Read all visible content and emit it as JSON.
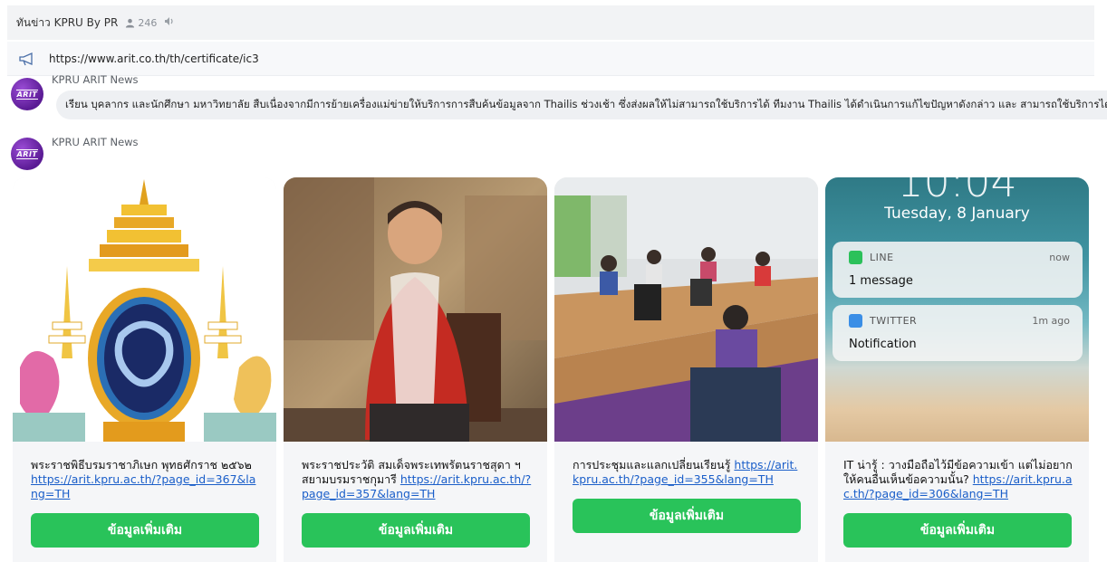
{
  "header": {
    "title": "ทันข่าว KPRU By PR",
    "member_count": "246"
  },
  "announcement": {
    "text": "https://www.arit.co.th/th/certificate/ic3"
  },
  "messages": [
    {
      "sender": "KPRU ARIT News",
      "avatar_text": "ARIT",
      "text": "เรียน บุคลากร และนักศึกษา มหาวิทยาลัย สืบเนื่องจากมีการย้ายเครื่องแม่ข่ายให้บริการการสืบค้นข้อมูลจาก Thailis ช่วงเช้า ซึ่งส่งผลให้ไม่สามารถใช้บริการได้ ทีมงาน Thailis ได้ดำเนินการแก้ไขปัญหาดังกล่าว และ สามารถใช้บริการได้เป็นปกติค"
    },
    {
      "sender": "KPRU ARIT News",
      "avatar_text": "ARIT"
    }
  ],
  "cards": [
    {
      "text": "พระราชพิธีบรมราชาภิเษก พุทธศักราช ๒๕๖๒ ",
      "link": "https://arit.kpru.ac.th/?page_id=367&lang=TH",
      "button": "ข้อมูลเพิ่มเติม"
    },
    {
      "text": "พระราชประวัติ สมเด็จพระเทพรัตนราชสุดา ฯ สยามบรมราชกุมารี ",
      "link": "https://arit.kpru.ac.th/?page_id=357&lang=TH",
      "button": "ข้อมูลเพิ่มเติม"
    },
    {
      "text": "การประชุมและแลกเปลี่ยนเรียนรู้ ",
      "link": "https://arit.kpru.ac.th/?page_id=355&lang=TH",
      "button": "ข้อมูลเพิ่มเติม"
    },
    {
      "text": "IT น่ารู้ : วางมือถือไว้มีข้อความเข้า แต่ไม่อยากให้คนอื่นเห็นข้อความนั้น? ",
      "link": "https://arit.kpru.ac.th/?page_id=306&lang=TH",
      "button": "ข้อมูลเพิ่มเติม",
      "phone": {
        "clock": "10:04",
        "date": "Tuesday, 8 January",
        "notifications": [
          {
            "app": "LINE",
            "time": "now",
            "message": "1 message",
            "color": "#2bc15a"
          },
          {
            "app": "TWITTER",
            "time": "1m ago",
            "message": "Notification",
            "color": "#3a8ee6"
          }
        ]
      }
    }
  ],
  "colors": {
    "accent_green": "#29c35a",
    "link_blue": "#1a5ec9",
    "avatar_purple": "#6a22a8"
  }
}
